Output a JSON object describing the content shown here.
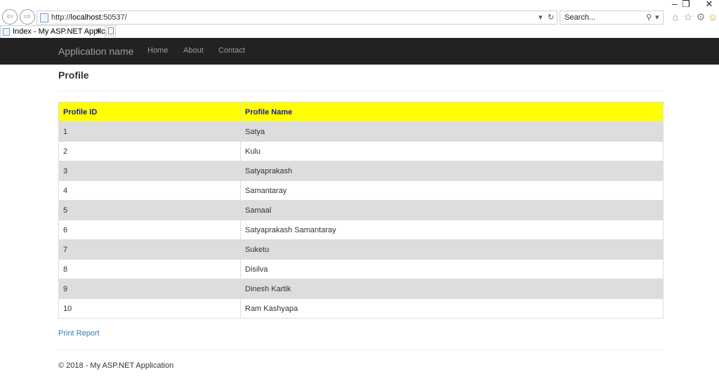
{
  "browser": {
    "url_prefix": "http://",
    "url_host": "localhost",
    "url_rest": ":50537/",
    "address_dropdown": "▾",
    "refresh_glyph": "↻",
    "search_placeholder": "Search...",
    "search_glyph": "⚲",
    "search_dropdown": "▾",
    "tab_title": "Index - My ASP.NET Applic...",
    "tab_close": "✕",
    "back_glyph": "⇦",
    "forward_glyph": "⇨",
    "window_buttons": {
      "minimize": "–",
      "restore": "❐",
      "close": "✕"
    },
    "toolbar_icons": {
      "home": "⌂",
      "favorites": "☆",
      "settings": "⚙",
      "smiley": "☺"
    }
  },
  "navbar": {
    "brand": "Application name",
    "links": [
      "Home",
      "About",
      "Contact"
    ]
  },
  "main": {
    "title": "Profile",
    "table": {
      "headers": [
        "Profile ID",
        "Profile Name"
      ],
      "rows": [
        [
          "1",
          "Satya"
        ],
        [
          "2",
          "Kulu"
        ],
        [
          "3",
          "Satyaprakash"
        ],
        [
          "4",
          "Samantaray"
        ],
        [
          "5",
          "Samaal"
        ],
        [
          "6",
          "Satyaprakash Samantaray"
        ],
        [
          "7",
          "Suketu"
        ],
        [
          "8",
          "Disilva"
        ],
        [
          "9",
          "Dinesh Kartik"
        ],
        [
          "10",
          "Ram Kashyapa"
        ]
      ]
    },
    "print_link": "Print Report"
  },
  "footer": {
    "text": "© 2018 - My ASP.NET Application"
  },
  "colors": {
    "navbar_bg": "#222222",
    "header_bg": "#ffff00",
    "header_text": "#1a1aa6",
    "stripe": "#dddddd",
    "link": "#337ab7"
  }
}
